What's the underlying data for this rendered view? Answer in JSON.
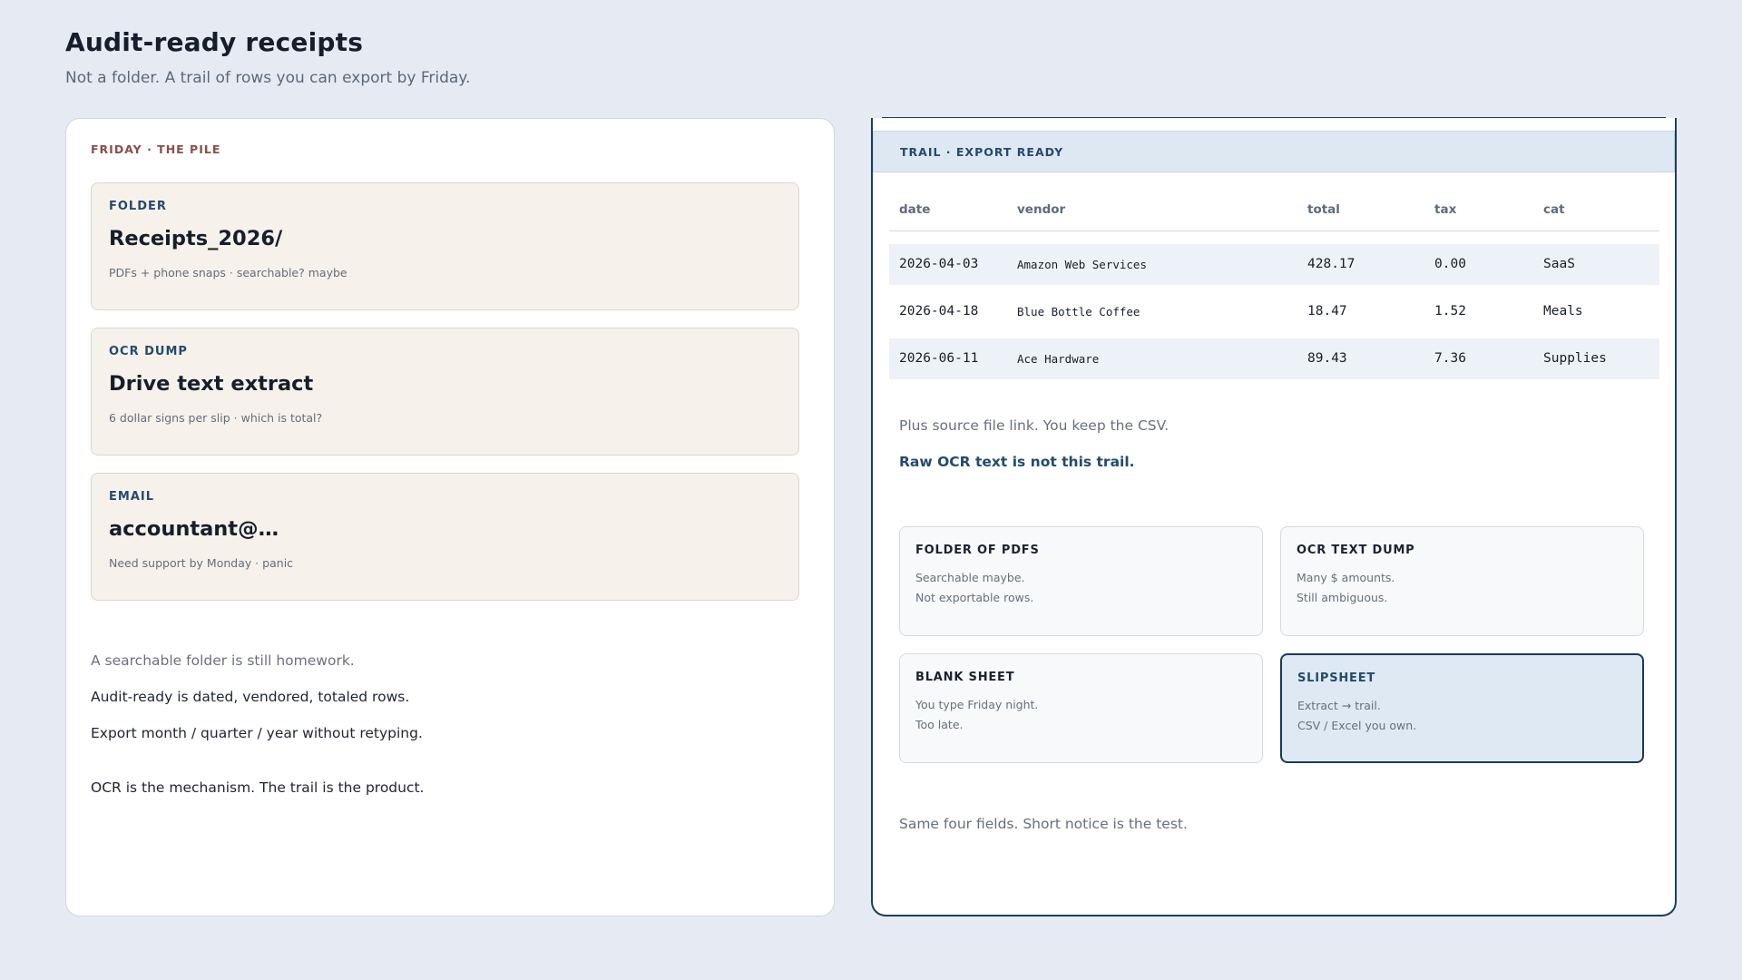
{
  "header": {
    "title": "Audit-ready receipts",
    "subtitle": "Not a folder. A trail of rows you can export by Friday."
  },
  "pile": {
    "eyebrow": "FRIDAY · THE PILE",
    "cards": [
      {
        "kicker": "FOLDER",
        "title": "Receipts_2026/",
        "note": "PDFs + phone snaps · searchable? maybe"
      },
      {
        "kicker": "OCR DUMP",
        "title": "Drive text extract",
        "note": "6 dollar signs per slip · which is total?"
      },
      {
        "kicker": "EMAIL",
        "title": "accountant@…",
        "note": "Need support by Monday · panic"
      }
    ],
    "lines": [
      "A searchable folder is still homework.",
      "Audit-ready is dated, vendored, totaled rows.",
      "Export month / quarter / year without retyping.",
      "OCR is the mechanism. The trail is the product."
    ]
  },
  "trail": {
    "eyebrow": "TRAIL · EXPORT READY",
    "columns": [
      "date",
      "vendor",
      "total",
      "tax",
      "cat"
    ],
    "rows": [
      {
        "date": "2026-04-03",
        "vendor": "Amazon Web Services",
        "total": "428.17",
        "tax": "0.00",
        "cat": "SaaS"
      },
      {
        "date": "2026-04-18",
        "vendor": "Blue Bottle Coffee",
        "total": "18.47",
        "tax": "1.52",
        "cat": "Meals"
      },
      {
        "date": "2026-06-11",
        "vendor": "Ace Hardware",
        "total": "89.43",
        "tax": "7.36",
        "cat": "Supplies"
      }
    ],
    "note": "Plus source file link. You keep the CSV.",
    "callout": "Raw OCR text is not this trail.",
    "options": [
      {
        "title": "FOLDER OF PDFS",
        "lines": [
          "Searchable maybe.",
          "Not exportable rows."
        ]
      },
      {
        "title": "OCR TEXT DUMP",
        "lines": [
          "Many $ amounts.",
          "Still ambiguous."
        ]
      },
      {
        "title": "BLANK SHEET",
        "lines": [
          "You type Friday night.",
          "Too late."
        ]
      },
      {
        "title": "SLIPSHEET",
        "lines": [
          "Extract → trail.",
          "CSV / Excel you own."
        ]
      }
    ],
    "footer": "Same four fields. Short notice is the test."
  }
}
